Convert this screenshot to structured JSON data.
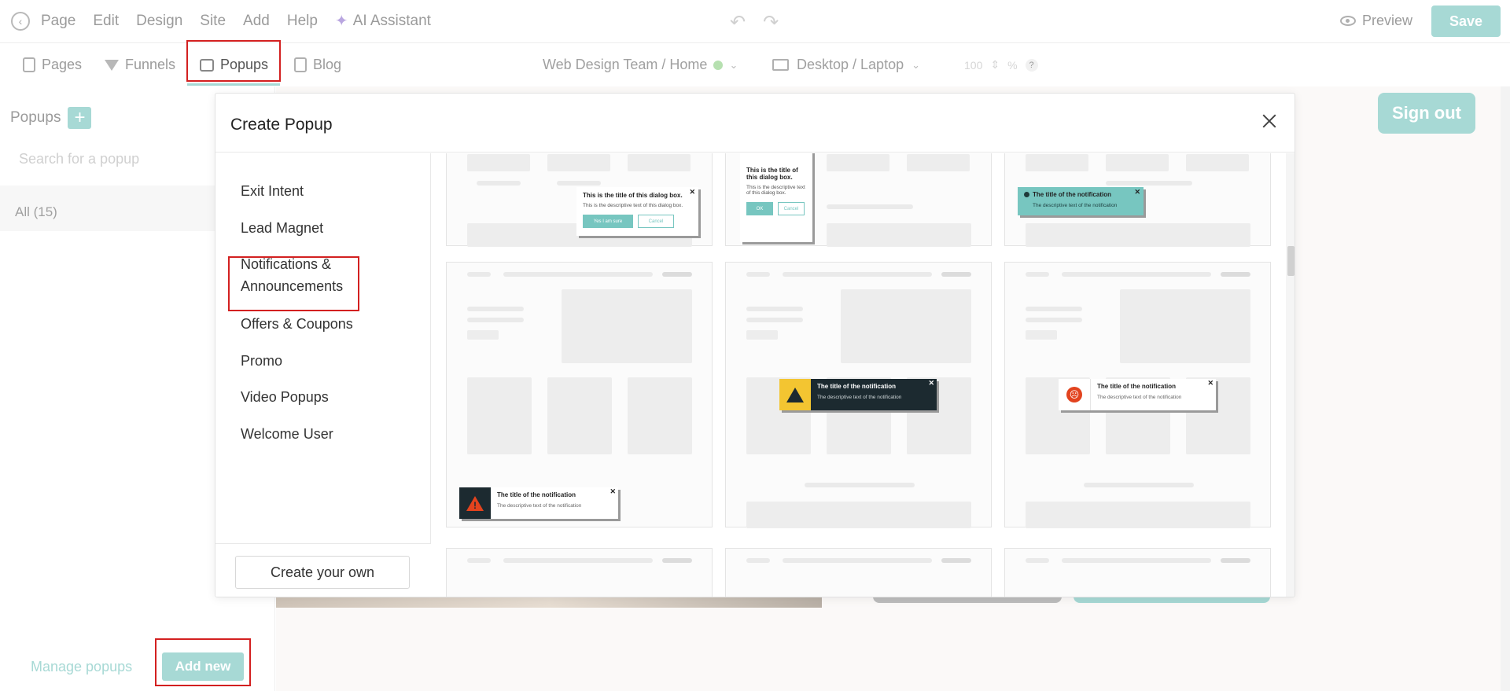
{
  "topbar": {
    "menu": [
      "Page",
      "Edit",
      "Design",
      "Site",
      "Add",
      "Help"
    ],
    "ai_assistant": "AI Assistant",
    "preview": "Preview",
    "save": "Save"
  },
  "subbar": {
    "tabs": [
      "Pages",
      "Funnels",
      "Popups",
      "Blog"
    ],
    "active_tab": "Popups",
    "site": "Web Design Team / Home",
    "device": "Desktop / Laptop",
    "zoom": "100",
    "zoom_unit": "%",
    "help": "?"
  },
  "left_panel": {
    "title": "Popups",
    "search_placeholder": "Search for a popup",
    "all_label": "All (15)",
    "manage": "Manage popups",
    "add_new": "Add new"
  },
  "background": {
    "sign_out": "Sign out"
  },
  "modal": {
    "title": "Create Popup",
    "categories": [
      "Exit Intent",
      "Lead Magnet",
      "Notifications & Announcements",
      "Offers & Coupons",
      "Promo",
      "Video Popups",
      "Welcome User"
    ],
    "selected_category": "Notifications & Announcements",
    "create_own": "Create your own",
    "templates": {
      "dialog_title": "This is the title of this dialog box.",
      "dialog_desc": "This is the descriptive text of this dialog box.",
      "dialog_yes": "Yes I am sure",
      "dialog_cancel": "Cancel",
      "dialog2_title": "This is the title of this dialog box.",
      "dialog2_desc": "This is the descriptive text of this dialog box.",
      "dialog2_ok": "OK",
      "dialog2_cancel": "Cancel",
      "notif_title": "The title of the notification",
      "notif_desc": "The descriptive text of the notification"
    }
  },
  "colors": {
    "accent": "#a7d9d5",
    "highlight": "#d32020",
    "warning_red": "#e2431e",
    "warning_yellow": "#f3c531",
    "dark_notif": "#1c2a30",
    "teal_notif": "#77c6c0"
  }
}
